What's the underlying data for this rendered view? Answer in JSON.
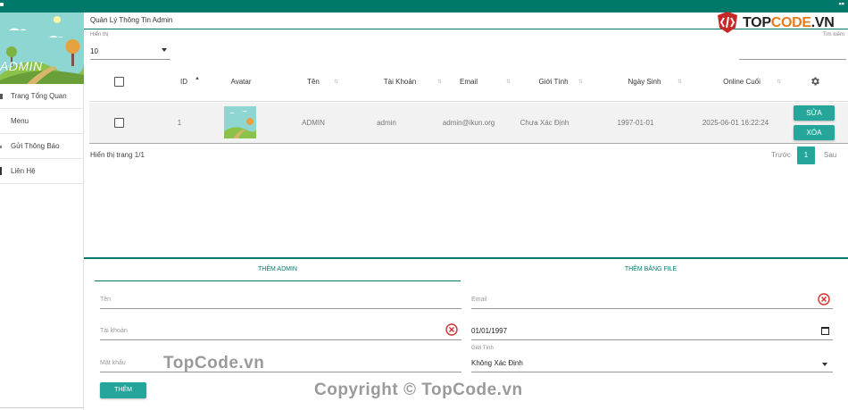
{
  "sidebar": {
    "brand_text": "ADMIN",
    "items": [
      {
        "label": "Trang Tổng Quan",
        "icon": "home-icon"
      },
      {
        "label": "Menu",
        "icon": ""
      },
      {
        "label": "Gửi Thông Báo",
        "icon": "bell-icon"
      },
      {
        "label": "Liên Hệ",
        "icon": "contact-icon"
      }
    ]
  },
  "page": {
    "title": "Quản Lý Thông Tin Admin",
    "show_label": "Hiển thị",
    "show_value": "10",
    "search_label": "Tìm kiếm"
  },
  "table": {
    "headers": {
      "id": "ID",
      "avatar": "Avatar",
      "name": "Tên",
      "account": "Tài Khoản",
      "email": "Email",
      "gender": "Giới Tính",
      "dob": "Ngày Sinh",
      "last_online": "Online Cuối"
    },
    "rows": [
      {
        "id": "1",
        "name": "ADMIN",
        "account": "admin",
        "email": "admin@ikun.org",
        "gender": "Chưa Xác Định",
        "dob": "1997-01-01",
        "last_online": "2025-06-01 16:22:24",
        "edit_label": "SỬA",
        "delete_label": "XÓA"
      }
    ],
    "info": "Hiển thị trang 1/1",
    "pager": {
      "prev": "Trước",
      "current": "1",
      "next": "Sau"
    }
  },
  "form": {
    "tab_add": "THÊM ADMIN",
    "tab_file": "THÊM BẰNG FILE",
    "name_placeholder": "Tên",
    "account_placeholder": "Tài khoản",
    "password_placeholder": "Mật khẩu",
    "email_placeholder": "Email",
    "dob_value": "01/01/1997",
    "gender_label": "Giới Tính",
    "gender_value": "Không Xác Định",
    "submit_label": "THÊM"
  },
  "logo": {
    "prefix": "TOP",
    "accent": "CODE",
    "suffix": ".VN"
  },
  "watermarks": [
    "TopCode.vn",
    "Copyright © TopCode.vn"
  ],
  "colors": {
    "primary": "#00796b",
    "button": "#26a69a",
    "error": "#d32f2f",
    "logo_accent": "#e57a1f"
  }
}
